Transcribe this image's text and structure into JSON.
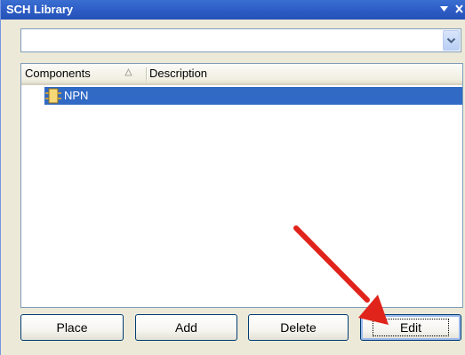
{
  "panel": {
    "title": "SCH Library",
    "title_controls": [
      {
        "icon": "chevron-down-icon"
      },
      {
        "icon": "close-icon"
      }
    ]
  },
  "filter": {
    "value": "",
    "dropdown_icon": "chevron-down-icon"
  },
  "list": {
    "columns": [
      "Components",
      "Description"
    ],
    "sort_icon": "sort-up-icon",
    "rows": [
      {
        "icon": "component-icon",
        "name": "NPN",
        "selected": true
      }
    ]
  },
  "buttons": {
    "place": "Place",
    "add": "Add",
    "delete": "Delete",
    "edit": "Edit"
  },
  "annotation": {
    "color": "#e0241b",
    "points_to": "edit-button"
  }
}
